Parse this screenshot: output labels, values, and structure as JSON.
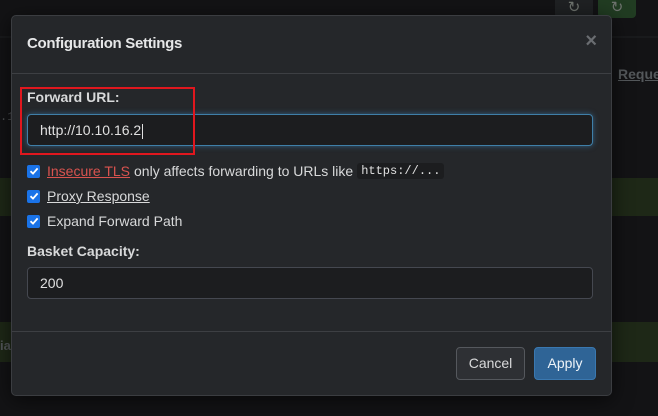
{
  "background": {
    "column_header": "Reque",
    "left_fragment": ".1",
    "left_fragment2": "ia",
    "refresh_icon": "refresh-icon"
  },
  "modal": {
    "title": "Configuration Settings",
    "close_glyph": "×",
    "forward_url": {
      "label": "Forward URL:",
      "value": "http://10.10.16.2"
    },
    "options": {
      "insecure_tls_link": "Insecure TLS",
      "insecure_tls_text": "only affects forwarding to URLs like",
      "insecure_tls_code": "https://...",
      "proxy_response": "Proxy Response",
      "expand_forward_path": "Expand Forward Path"
    },
    "checked": {
      "insecure_tls": true,
      "proxy_response": true,
      "expand_forward_path": true
    },
    "basket_capacity": {
      "label": "Basket Capacity:",
      "value": "200"
    },
    "buttons": {
      "cancel": "Cancel",
      "apply": "Apply"
    }
  },
  "colors": {
    "accent": "#2f6496",
    "checkbox": "#1a73e8",
    "annotation": "#e0171e",
    "link_red": "#d9534f"
  }
}
